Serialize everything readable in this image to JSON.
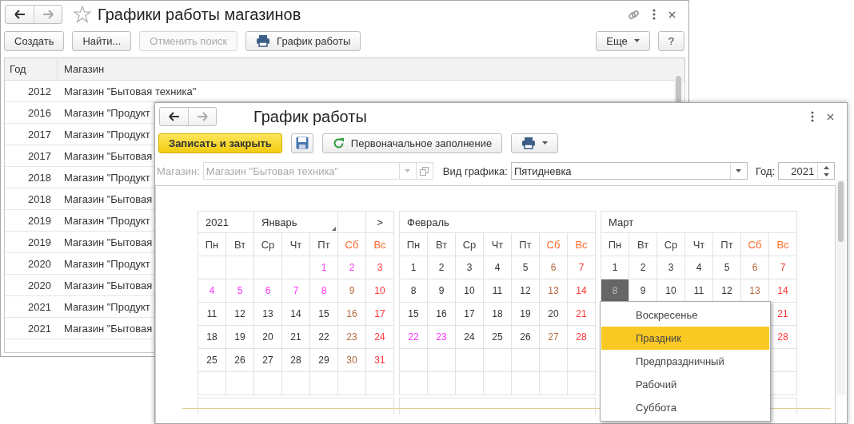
{
  "list_window": {
    "title": "Графики работы магазинов",
    "toolbar": [
      {
        "label": "Создать",
        "kind": "text",
        "disabled": false
      },
      {
        "label": "Найти...",
        "kind": "text",
        "disabled": false
      },
      {
        "label": "Отменить поиск",
        "kind": "text",
        "disabled": true
      },
      {
        "label": "График работы",
        "kind": "print",
        "disabled": false
      }
    ],
    "toolbar_right": [
      {
        "label": "Еще",
        "kind": "menu",
        "disabled": false
      },
      {
        "label": "?",
        "kind": "text",
        "disabled": false
      }
    ],
    "table": {
      "columns": [
        "Год",
        "Магазин"
      ],
      "rows": [
        {
          "year": "2012",
          "shop": "Магазин \"Бытовая техника\""
        },
        {
          "year": "2016",
          "shop": "Магазин \"Продукт"
        },
        {
          "year": "2017",
          "shop": "Магазин \"Продукт"
        },
        {
          "year": "2017",
          "shop": "Магазин \"Бытовая"
        },
        {
          "year": "2018",
          "shop": "Магазин \"Продукт"
        },
        {
          "year": "2018",
          "shop": "Магазин \"Бытовая"
        },
        {
          "year": "2019",
          "shop": "Магазин \"Продукт"
        },
        {
          "year": "2019",
          "shop": "Магазин \"Бытовая"
        },
        {
          "year": "2020",
          "shop": "Магазин \"Продукт"
        },
        {
          "year": "2020",
          "shop": "Магазин \"Бытовая"
        },
        {
          "year": "2021",
          "shop": "Магазин \"Продукт"
        },
        {
          "year": "2021",
          "shop": "Магазин \"Бытовая"
        }
      ]
    }
  },
  "form_window": {
    "title": "График работы",
    "toolbar": [
      {
        "label": "Записать и закрыть",
        "kind": "primary"
      },
      {
        "kind": "save"
      },
      {
        "label": "Первоначальное заполнение",
        "kind": "refresh"
      },
      {
        "kind": "print-menu"
      }
    ],
    "fields": [
      {
        "label": "Магазин:",
        "value": "Магазин \"Бытовая техника\"",
        "kind": "select-open",
        "disabled": true
      },
      {
        "label": "Вид графика:",
        "value": "Пятидневка",
        "kind": "select",
        "disabled": false
      },
      {
        "label": "Год:",
        "value": "2021",
        "kind": "spin",
        "disabled": false
      }
    ],
    "calendars": [
      {
        "year": "2021",
        "month": "Январь",
        "next": ">",
        "weekdays": [
          {
            "label": "Пн",
            "weekend": false
          },
          {
            "label": "Вт",
            "weekend": false
          },
          {
            "label": "Ср",
            "weekend": false
          },
          {
            "label": "Чт",
            "weekend": false
          },
          {
            "label": "Пт",
            "weekend": false
          },
          {
            "label": "Сб",
            "weekend": true
          },
          {
            "label": "Вс",
            "weekend": true
          }
        ],
        "weeks": [
          [
            {
              "kind": "blank"
            },
            {
              "kind": "blank"
            },
            {
              "kind": "blank"
            },
            {
              "kind": "blank"
            },
            {
              "d": "1",
              "kind": "holiday",
              "selected": false
            },
            {
              "d": "2",
              "kind": "holiday",
              "selected": false
            },
            {
              "d": "3",
              "kind": "sunday",
              "selected": false
            }
          ],
          [
            {
              "d": "4",
              "kind": "holiday",
              "selected": false
            },
            {
              "d": "5",
              "kind": "holiday",
              "selected": false
            },
            {
              "d": "6",
              "kind": "holiday",
              "selected": false
            },
            {
              "d": "7",
              "kind": "holiday",
              "selected": false
            },
            {
              "d": "8",
              "kind": "holiday",
              "selected": false
            },
            {
              "d": "9",
              "kind": "saturday",
              "selected": false
            },
            {
              "d": "10",
              "kind": "sunday",
              "selected": false
            }
          ],
          [
            {
              "d": "11",
              "kind": "work",
              "selected": false
            },
            {
              "d": "12",
              "kind": "work",
              "selected": false
            },
            {
              "d": "13",
              "kind": "work",
              "selected": false
            },
            {
              "d": "14",
              "kind": "work",
              "selected": false
            },
            {
              "d": "15",
              "kind": "work",
              "selected": false
            },
            {
              "d": "16",
              "kind": "saturday",
              "selected": false
            },
            {
              "d": "17",
              "kind": "sunday",
              "selected": false
            }
          ],
          [
            {
              "d": "18",
              "kind": "work",
              "selected": false
            },
            {
              "d": "19",
              "kind": "work",
              "selected": false
            },
            {
              "d": "20",
              "kind": "work",
              "selected": false
            },
            {
              "d": "21",
              "kind": "work",
              "selected": false
            },
            {
              "d": "22",
              "kind": "work",
              "selected": false
            },
            {
              "d": "23",
              "kind": "saturday",
              "selected": false
            },
            {
              "d": "24",
              "kind": "sunday",
              "selected": false
            }
          ],
          [
            {
              "d": "25",
              "kind": "work",
              "selected": false
            },
            {
              "d": "26",
              "kind": "work",
              "selected": false
            },
            {
              "d": "27",
              "kind": "work",
              "selected": false
            },
            {
              "d": "28",
              "kind": "work",
              "selected": false
            },
            {
              "d": "29",
              "kind": "work",
              "selected": false
            },
            {
              "d": "30",
              "kind": "saturday",
              "selected": false
            },
            {
              "d": "31",
              "kind": "sunday",
              "selected": false
            }
          ],
          [
            {
              "kind": "blank"
            },
            {
              "kind": "blank"
            },
            {
              "kind": "blank"
            },
            {
              "kind": "blank"
            },
            {
              "kind": "blank"
            },
            {
              "kind": "blank"
            },
            {
              "kind": "blank"
            }
          ]
        ]
      },
      {
        "month": "Февраль",
        "weekdays": [
          {
            "label": "Пн",
            "weekend": false
          },
          {
            "label": "Вт",
            "weekend": false
          },
          {
            "label": "Ср",
            "weekend": false
          },
          {
            "label": "Чт",
            "weekend": false
          },
          {
            "label": "Пт",
            "weekend": false
          },
          {
            "label": "Сб",
            "weekend": true
          },
          {
            "label": "Вс",
            "weekend": true
          }
        ],
        "weeks": [
          [
            {
              "d": "1",
              "kind": "work",
              "selected": false
            },
            {
              "d": "2",
              "kind": "work",
              "selected": false
            },
            {
              "d": "3",
              "kind": "work",
              "selected": false
            },
            {
              "d": "4",
              "kind": "work",
              "selected": false
            },
            {
              "d": "5",
              "kind": "work",
              "selected": false
            },
            {
              "d": "6",
              "kind": "saturday",
              "selected": false
            },
            {
              "d": "7",
              "kind": "sunday",
              "selected": false
            }
          ],
          [
            {
              "d": "8",
              "kind": "work",
              "selected": false
            },
            {
              "d": "9",
              "kind": "work",
              "selected": false
            },
            {
              "d": "10",
              "kind": "work",
              "selected": false
            },
            {
              "d": "11",
              "kind": "work",
              "selected": false
            },
            {
              "d": "12",
              "kind": "work",
              "selected": false
            },
            {
              "d": "13",
              "kind": "saturday",
              "selected": false
            },
            {
              "d": "14",
              "kind": "sunday",
              "selected": false
            }
          ],
          [
            {
              "d": "15",
              "kind": "work",
              "selected": false
            },
            {
              "d": "16",
              "kind": "work",
              "selected": false
            },
            {
              "d": "17",
              "kind": "work",
              "selected": false
            },
            {
              "d": "18",
              "kind": "work",
              "selected": false
            },
            {
              "d": "19",
              "kind": "work",
              "selected": false
            },
            {
              "d": "20",
              "kind": "work",
              "selected": false
            },
            {
              "d": "21",
              "kind": "sunday",
              "selected": false
            }
          ],
          [
            {
              "d": "22",
              "kind": "holiday",
              "selected": false
            },
            {
              "d": "23",
              "kind": "holiday",
              "selected": false
            },
            {
              "d": "24",
              "kind": "work",
              "selected": false
            },
            {
              "d": "25",
              "kind": "work",
              "selected": false
            },
            {
              "d": "26",
              "kind": "work",
              "selected": false
            },
            {
              "d": "27",
              "kind": "saturday",
              "selected": false
            },
            {
              "d": "28",
              "kind": "sunday",
              "selected": false
            }
          ],
          [
            {
              "kind": "blank"
            },
            {
              "kind": "blank"
            },
            {
              "kind": "blank"
            },
            {
              "kind": "blank"
            },
            {
              "kind": "blank"
            },
            {
              "kind": "blank"
            },
            {
              "kind": "blank"
            }
          ],
          [
            {
              "kind": "blank"
            },
            {
              "kind": "blank"
            },
            {
              "kind": "blank"
            },
            {
              "kind": "blank"
            },
            {
              "kind": "blank"
            },
            {
              "kind": "blank"
            },
            {
              "kind": "blank"
            }
          ]
        ]
      },
      {
        "month": "Март",
        "weekdays": [
          {
            "label": "Пн",
            "weekend": false
          },
          {
            "label": "Вт",
            "weekend": false
          },
          {
            "label": "Ср",
            "weekend": false
          },
          {
            "label": "Чт",
            "weekend": false
          },
          {
            "label": "Пт",
            "weekend": false
          },
          {
            "label": "Сб",
            "weekend": true
          },
          {
            "label": "Вс",
            "weekend": true
          }
        ],
        "weeks": [
          [
            {
              "d": "1",
              "kind": "work",
              "selected": false
            },
            {
              "d": "2",
              "kind": "work",
              "selected": false
            },
            {
              "d": "3",
              "kind": "work",
              "selected": false
            },
            {
              "d": "4",
              "kind": "work",
              "selected": false
            },
            {
              "d": "5",
              "kind": "work",
              "selected": false
            },
            {
              "d": "6",
              "kind": "saturday",
              "selected": false
            },
            {
              "d": "7",
              "kind": "sunday",
              "selected": false
            }
          ],
          [
            {
              "d": "8",
              "kind": "holiday",
              "selected": true
            },
            {
              "d": "9",
              "kind": "work",
              "selected": false
            },
            {
              "d": "10",
              "kind": "work",
              "selected": false
            },
            {
              "d": "11",
              "kind": "work",
              "selected": false
            },
            {
              "d": "12",
              "kind": "work",
              "selected": false
            },
            {
              "d": "13",
              "kind": "saturday",
              "selected": false
            },
            {
              "d": "14",
              "kind": "sunday",
              "selected": false
            }
          ],
          [
            {
              "kind": "blank"
            },
            {
              "kind": "blank"
            },
            {
              "kind": "blank"
            },
            {
              "kind": "blank"
            },
            {
              "kind": "blank"
            },
            {
              "kind": "blank"
            },
            {
              "d": "21",
              "kind": "sunday",
              "selected": false
            }
          ],
          [
            {
              "kind": "blank"
            },
            {
              "kind": "blank"
            },
            {
              "kind": "blank"
            },
            {
              "kind": "blank"
            },
            {
              "kind": "blank"
            },
            {
              "kind": "blank"
            },
            {
              "d": "28",
              "kind": "sunday",
              "selected": false
            }
          ],
          [
            {
              "kind": "blank"
            },
            {
              "kind": "blank"
            },
            {
              "kind": "blank"
            },
            {
              "kind": "blank"
            },
            {
              "kind": "blank"
            },
            {
              "kind": "blank"
            },
            {
              "kind": "blank"
            }
          ],
          [
            {
              "kind": "blank"
            },
            {
              "kind": "blank"
            },
            {
              "kind": "blank"
            },
            {
              "kind": "blank"
            },
            {
              "kind": "blank"
            },
            {
              "kind": "blank"
            },
            {
              "kind": "blank"
            }
          ]
        ]
      }
    ],
    "context_menu": {
      "items": [
        {
          "label": "Воскресенье",
          "selected": false
        },
        {
          "label": "Праздник",
          "selected": true
        },
        {
          "label": "Предпраздничный",
          "selected": false
        },
        {
          "label": "Рабочий",
          "selected": false
        },
        {
          "label": "Суббота",
          "selected": false
        }
      ]
    }
  }
}
